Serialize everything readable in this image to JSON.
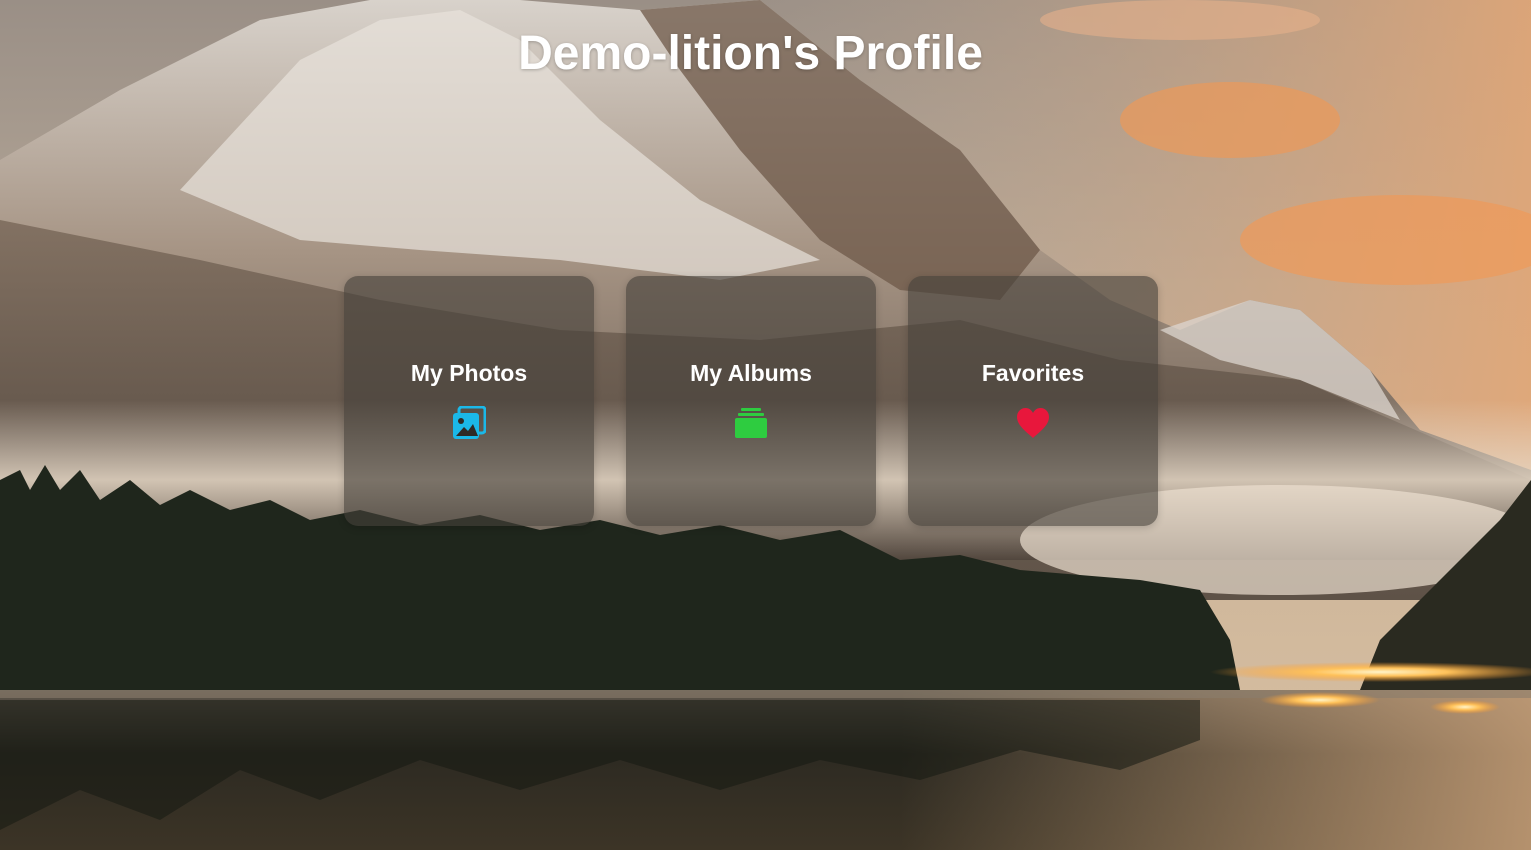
{
  "page": {
    "title": "Demo-lition's Profile"
  },
  "cards": [
    {
      "label": "My Photos",
      "icon": "photos-icon",
      "icon_color": "#1bb8e8"
    },
    {
      "label": "My Albums",
      "icon": "albums-icon",
      "icon_color": "#2ecc40"
    },
    {
      "label": "Favorites",
      "icon": "heart-icon",
      "icon_color": "#e8173c"
    }
  ],
  "theme": {
    "card_background": "rgba(70,64,58,0.62)",
    "text_color": "#ffffff",
    "background_image": "mountain-lake-landscape"
  }
}
